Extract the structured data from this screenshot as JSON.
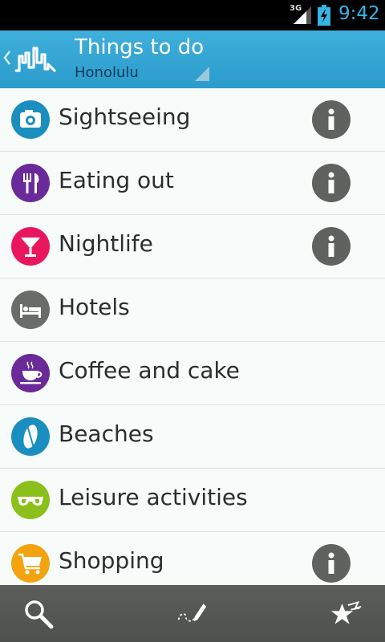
{
  "status_bar": {
    "network": "3G",
    "time": "9:42",
    "accent_color": "#33b5e5"
  },
  "action_bar": {
    "title": "Things to do",
    "subtitle": "Honolulu",
    "background_color": "#35a6d4"
  },
  "categories": [
    {
      "label": "Sightseeing",
      "icon": "camera-icon",
      "color": "#1a8fbf",
      "has_info": true
    },
    {
      "label": "Eating out",
      "icon": "cutlery-icon",
      "color": "#6a2a9a",
      "has_info": true
    },
    {
      "label": "Nightlife",
      "icon": "cocktail-icon",
      "color": "#e8175d",
      "has_info": true
    },
    {
      "label": "Hotels",
      "icon": "bed-icon",
      "color": "#6a6c6a",
      "has_info": false
    },
    {
      "label": "Coffee and cake",
      "icon": "coffee-cup-icon",
      "color": "#6a2a9a",
      "has_info": false
    },
    {
      "label": "Beaches",
      "icon": "surfboard-icon",
      "color": "#1a8fbf",
      "has_info": false
    },
    {
      "label": "Leisure activities",
      "icon": "sunglasses-icon",
      "color": "#8bbf1a",
      "has_info": false
    },
    {
      "label": "Shopping",
      "icon": "shopping-cart-icon",
      "color": "#f2a30f",
      "has_info": true
    }
  ],
  "bottom_bar": {
    "buttons": [
      "search-icon",
      "route-pen-icon",
      "favorites-stars-icon"
    ]
  }
}
